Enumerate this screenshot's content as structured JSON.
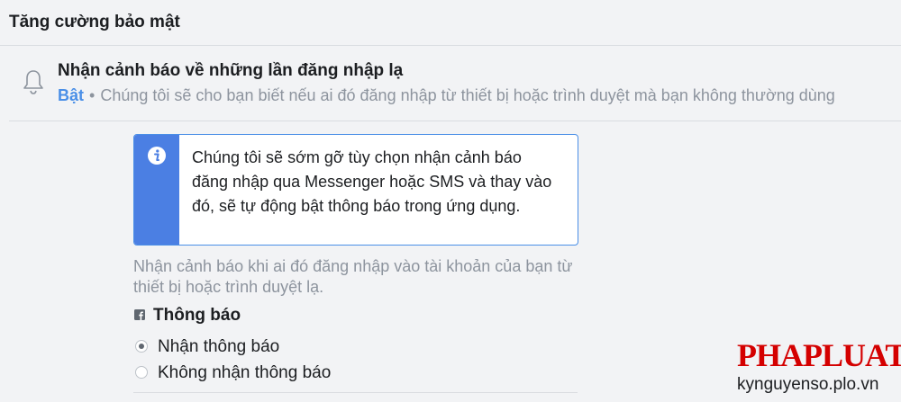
{
  "section": {
    "title": "Tăng cường bảo mật"
  },
  "login_alert": {
    "icon": "bell-icon",
    "title": "Nhận cảnh báo về những lần đăng nhập lạ",
    "status": "Bật",
    "separator": "•",
    "description": "Chúng tôi sẽ cho bạn biết nếu ai đó đăng nhập từ thiết bị hoặc trình duyệt mà bạn không thường dùng"
  },
  "notice": {
    "icon": "info-icon",
    "accent_color": "#4b7fe3",
    "text": "Chúng tôi sẽ sớm gỡ tùy chọn nhận cảnh báo đăng nhập qua Messenger hoặc SMS và thay vào đó, sẽ tự động bật thông báo trong ứng dụng."
  },
  "alert_description": "Nhận cảnh báo khi ai đó đăng nhập vào tài khoản của bạn từ thiết bị hoặc trình duyệt lạ.",
  "notifications": {
    "icon": "facebook-icon",
    "heading": "Thông báo",
    "options": [
      {
        "label": "Nhận thông báo",
        "selected": true
      },
      {
        "label": "Không nhận thông báo",
        "selected": false
      }
    ]
  },
  "watermark": {
    "logo": "PHAPLUAT",
    "url": "kynguyenso.plo.vn"
  }
}
